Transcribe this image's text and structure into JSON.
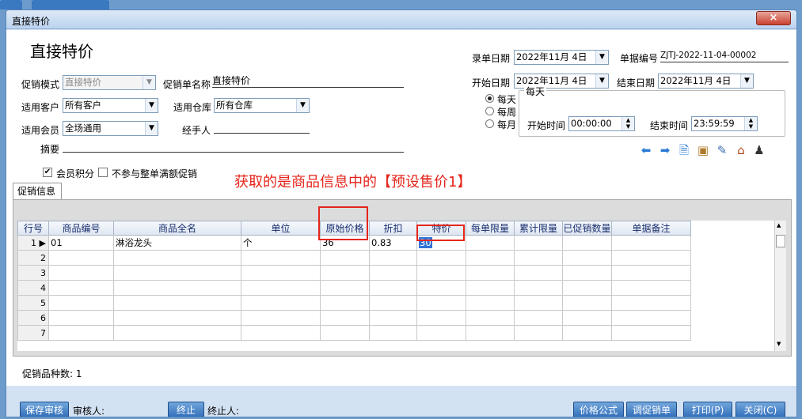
{
  "window": {
    "title": "直接特价",
    "close": "×"
  },
  "page_title": "直接特价",
  "form": {
    "promo_mode_label": "促销模式",
    "promo_mode_value": "直接特价",
    "promo_name_label": "促销单名称",
    "promo_name_value": "直接特价",
    "customer_label": "适用客户",
    "customer_value": "所有客户",
    "warehouse_label": "适用仓库",
    "warehouse_value": "所有仓库",
    "member_label": "适用会员",
    "member_value": "全场通用",
    "handler_label": "经手人",
    "handler_value": "",
    "summary_label": "摘要",
    "summary_value": "",
    "entry_date_label": "录单日期",
    "entry_date_value": "2022年11月 4日",
    "doc_no_label": "单据编号",
    "doc_no_value": "ZJTJ-2022-11-04-00002",
    "start_date_label": "开始日期",
    "start_date_value": "2022年11月 4日",
    "end_date_label": "结束日期",
    "end_date_value": "2022年11月 4日",
    "freq_group_label": "每天",
    "freq_options": [
      "每天",
      "每周",
      "每月"
    ],
    "start_time_label": "开始时间",
    "start_time_value": "00:00:00",
    "end_time_label": "结束时间",
    "end_time_value": "23:59:59",
    "member_points_label": "会员积分",
    "member_points_checked": true,
    "exclude_label": "不参与整单满额促销",
    "exclude_checked": false
  },
  "annotation": "获取的是商品信息中的【预设售价1】",
  "tab_label": "促销信息",
  "table": {
    "headers": [
      "行号",
      "商品编号",
      "商品全名",
      "单位",
      "原始价格",
      "折扣",
      "特价",
      "每单限量",
      "累计限量",
      "已促销数量",
      "单据备注"
    ],
    "rows": [
      {
        "no": "1",
        "code": "01",
        "name": "淋浴龙头",
        "unit": "个",
        "orig": "36",
        "disc": "0.83",
        "special": "30",
        "per": "",
        "acc": "",
        "done": "",
        "remark": ""
      },
      {
        "no": "2",
        "code": "",
        "name": "",
        "unit": "",
        "orig": "",
        "disc": "",
        "special": "",
        "per": "",
        "acc": "",
        "done": "",
        "remark": ""
      },
      {
        "no": "3",
        "code": "",
        "name": "",
        "unit": "",
        "orig": "",
        "disc": "",
        "special": "",
        "per": "",
        "acc": "",
        "done": "",
        "remark": ""
      },
      {
        "no": "4",
        "code": "",
        "name": "",
        "unit": "",
        "orig": "",
        "disc": "",
        "special": "",
        "per": "",
        "acc": "",
        "done": "",
        "remark": ""
      },
      {
        "no": "5",
        "code": "",
        "name": "",
        "unit": "",
        "orig": "",
        "disc": "",
        "special": "",
        "per": "",
        "acc": "",
        "done": "",
        "remark": ""
      },
      {
        "no": "6",
        "code": "",
        "name": "",
        "unit": "",
        "orig": "",
        "disc": "",
        "special": "",
        "per": "",
        "acc": "",
        "done": "",
        "remark": ""
      },
      {
        "no": "7",
        "code": "",
        "name": "",
        "unit": "",
        "orig": "",
        "disc": "",
        "special": "",
        "per": "",
        "acc": "",
        "done": "",
        "remark": ""
      }
    ]
  },
  "status": "促销品种数: 1",
  "footer": {
    "save_audit": "保存审核",
    "auditor_label": "审核人:",
    "terminate": "终止",
    "terminator_label": "终止人:",
    "price_formula": "价格公式",
    "adjust_promo": "调促销单",
    "print": "打印(P)",
    "close": "关闭(C)"
  },
  "colors": {
    "accent": "#2d6bb7",
    "annotation": "#e5251c",
    "highlight_box": "#e6261b"
  }
}
